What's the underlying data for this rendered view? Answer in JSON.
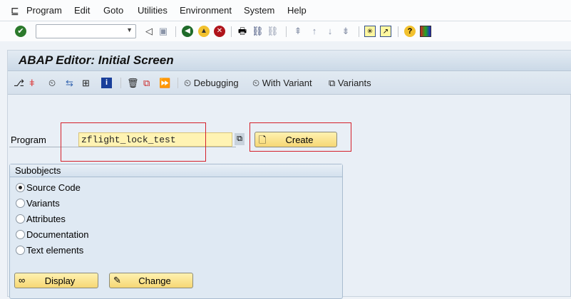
{
  "menubar": {
    "items": [
      "Program",
      "Edit",
      "Goto",
      "Utilities",
      "Environment",
      "System",
      "Help"
    ]
  },
  "toolbar": {
    "command_field": "",
    "icons": [
      "enter-icon",
      "back-arrow-icon",
      "save-icon",
      "back-icon",
      "exit-icon",
      "cancel-icon",
      "print-icon",
      "find-icon",
      "find-next-icon",
      "first-page-icon",
      "previous-page-icon",
      "next-page-icon",
      "last-page-icon",
      "new-session-icon",
      "shortcut-icon",
      "help-icon",
      "layout-icon"
    ]
  },
  "screen": {
    "title": "ABAP Editor: Initial Screen",
    "app_toolbar": {
      "debugging": "Debugging",
      "with_variant": "With Variant",
      "variants": "Variants"
    },
    "program_label": "Program",
    "program_value": "zflight_lock_test",
    "create_label": "Create",
    "subobjects": {
      "title": "Subobjects",
      "options": [
        {
          "label": "Source Code",
          "selected": true
        },
        {
          "label": "Variants",
          "selected": false
        },
        {
          "label": "Attributes",
          "selected": false
        },
        {
          "label": "Documentation",
          "selected": false
        },
        {
          "label": "Text elements",
          "selected": false
        }
      ],
      "display_label": "Display",
      "change_label": "Change"
    }
  }
}
